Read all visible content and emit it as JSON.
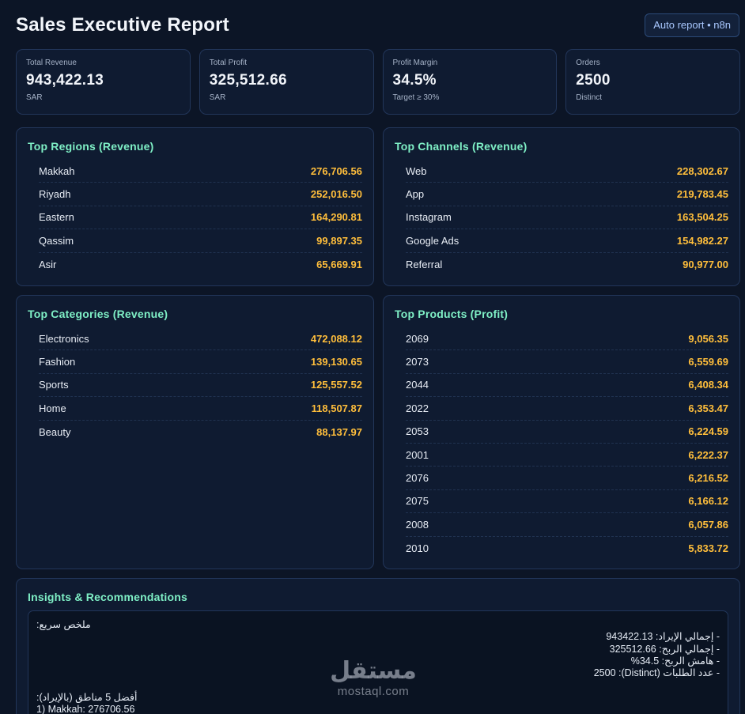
{
  "header": {
    "title": "Sales Executive Report",
    "badge": "Auto report • n8n"
  },
  "kpis": [
    {
      "label": "Total Revenue",
      "value": "943,422.13",
      "sub": "SAR"
    },
    {
      "label": "Total Profit",
      "value": "325,512.66",
      "sub": "SAR"
    },
    {
      "label": "Profit Margin",
      "value": "34.5%",
      "sub": "Target ≥ 30%"
    },
    {
      "label": "Orders",
      "value": "2500",
      "sub": "Distinct"
    }
  ],
  "regions": {
    "title": "Top Regions (Revenue)",
    "rows": [
      {
        "label": "Makkah",
        "value": "276,706.56"
      },
      {
        "label": "Riyadh",
        "value": "252,016.50"
      },
      {
        "label": "Eastern",
        "value": "164,290.81"
      },
      {
        "label": "Qassim",
        "value": "99,897.35"
      },
      {
        "label": "Asir",
        "value": "65,669.91"
      }
    ]
  },
  "channels": {
    "title": "Top Channels (Revenue)",
    "rows": [
      {
        "label": "Web",
        "value": "228,302.67"
      },
      {
        "label": "App",
        "value": "219,783.45"
      },
      {
        "label": "Instagram",
        "value": "163,504.25"
      },
      {
        "label": "Google Ads",
        "value": "154,982.27"
      },
      {
        "label": "Referral",
        "value": "90,977.00"
      }
    ]
  },
  "categories": {
    "title": "Top Categories (Revenue)",
    "rows": [
      {
        "label": "Electronics",
        "value": "472,088.12"
      },
      {
        "label": "Fashion",
        "value": "139,130.65"
      },
      {
        "label": "Sports",
        "value": "125,557.52"
      },
      {
        "label": "Home",
        "value": "118,507.87"
      },
      {
        "label": "Beauty",
        "value": "88,137.97"
      }
    ]
  },
  "products": {
    "title": "Top Products (Profit)",
    "rows": [
      {
        "label": "2069",
        "value": "9,056.35"
      },
      {
        "label": "2073",
        "value": "6,559.69"
      },
      {
        "label": "2044",
        "value": "6,408.34"
      },
      {
        "label": "2022",
        "value": "6,353.47"
      },
      {
        "label": "2053",
        "value": "6,224.59"
      },
      {
        "label": "2001",
        "value": "6,222.37"
      },
      {
        "label": "2076",
        "value": "6,216.52"
      },
      {
        "label": "2075",
        "value": "6,166.12"
      },
      {
        "label": "2008",
        "value": "6,057.86"
      },
      {
        "label": "2010",
        "value": "5,833.72"
      }
    ]
  },
  "insights": {
    "title": "Insights & Recommendations",
    "lines": [
      "ملخص سريع:",
      "- إجمالي الإيراد: 943422.13",
      "- إجمالي الربح: 325512.66",
      "- هامش الربح: 34.5%",
      "- عدد الطلبات (Distinct): 2500",
      "",
      "أفضل 5 مناطق (بالإيراد):",
      "1) Makkah: 276706.56"
    ]
  },
  "watermark": {
    "mark": "مستقل",
    "text": "mostaql.com"
  }
}
